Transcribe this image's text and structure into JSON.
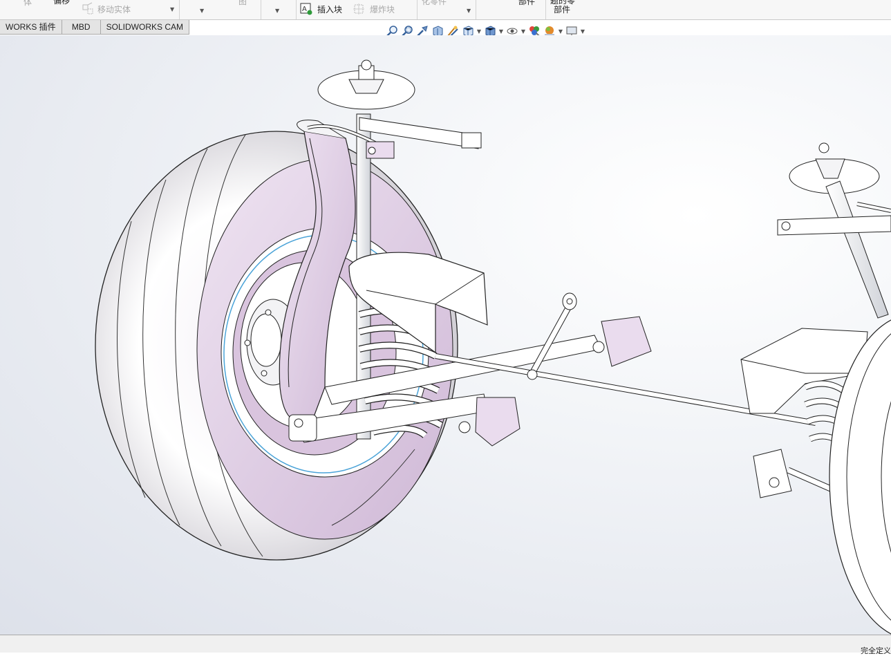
{
  "ribbon": {
    "cut_left_label": "体",
    "offset_label": "偏移",
    "move_body_label": "移动实体",
    "partial_label_1": "图",
    "insert_block_label": "插入块",
    "explode_label": "爆炸块",
    "partial_label_2": "化零件",
    "part_label": "部件",
    "top_part_label": "题的零",
    "top_part_label_2": "部件"
  },
  "tabs": [
    {
      "label": "WORKS 插件"
    },
    {
      "label": "MBD"
    },
    {
      "label": "SOLIDWORKS CAM"
    }
  ],
  "hud": {
    "icons": [
      "zoom-to-fit-icon",
      "zoom-to-area-icon",
      "previous-view-icon",
      "section-view-icon",
      "dynamic-annotation-icon",
      "view-orientation-icon",
      "display-style-icon",
      "hide-show-items-icon",
      "edit-appearance-icon",
      "apply-scene-icon",
      "view-settings-icon"
    ]
  },
  "status": {
    "text": "完全定义"
  },
  "colors": {
    "accent_tire": "#d8c3dd",
    "ribbon_bg": "#f7f7f7",
    "tab_bg": "#e4e4e4"
  }
}
